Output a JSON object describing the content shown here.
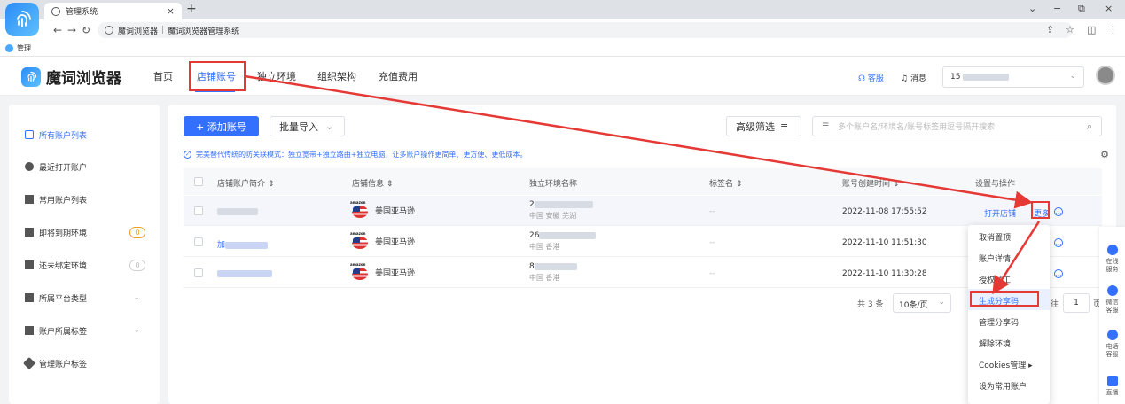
{
  "browser": {
    "tab_title": "管理系统",
    "tab_close": "×",
    "new_tab": "+",
    "url_site": "魔词浏览器",
    "url_sep": "|",
    "url_title": "魔词浏览器管理系统",
    "bookmark": "管理",
    "win_min": "−",
    "win_max": "⧉",
    "win_close": "×",
    "win_dropdown": "⌄"
  },
  "app": {
    "brand": "魔词浏览器",
    "nav": [
      "首页",
      "店铺账号",
      "独立环境",
      "组织架构",
      "充值费用"
    ],
    "active_nav_index": 1,
    "service_link": "客服",
    "message_link": "消息",
    "account_prefix": "15"
  },
  "sidebar": {
    "items": [
      {
        "label": "所有账户列表",
        "icon": "grid-icon",
        "active": true
      },
      {
        "label": "最近打开账户",
        "icon": "clock-icon"
      },
      {
        "label": "常用账户列表",
        "icon": "table-icon"
      },
      {
        "label": "即将到期环境",
        "icon": "calendar-icon",
        "badge": "0",
        "badge_color": "#f0a020"
      },
      {
        "label": "还未绑定环境",
        "icon": "link-icon",
        "badge": "0",
        "badge_color": "#bbbbbb"
      },
      {
        "label": "所属平台类型",
        "icon": "platform-icon",
        "chevron": true
      },
      {
        "label": "账户所属标签",
        "icon": "bookmark-icon",
        "chevron": true
      },
      {
        "label": "管理账户标签",
        "icon": "tag-icon"
      }
    ]
  },
  "toolbar": {
    "add_account": "+ 添加账号",
    "batch_import": "批量导入",
    "advanced_filter": "高级筛选",
    "search_placeholder": "多个账户名/环境名/账号标签用逗号隔开搜索"
  },
  "notice": "完美替代传统的防关联模式：独立宽带+独立路由+独立电脑，让多账户操作更简单、更方便、更低成本。",
  "table": {
    "headers": [
      "店铺账户简介",
      "店铺信息",
      "独立环境名称",
      "标签名",
      "账号创建时间",
      "设置与操作"
    ],
    "rows": [
      {
        "prefix": "",
        "store": "美国亚马逊",
        "env_prefix": "2",
        "env_region": "中国 安徽 芜湖",
        "tag": "--",
        "created": "2022-11-08 17:55:52",
        "action": "打开店铺",
        "more": "更多"
      },
      {
        "prefix": "加",
        "store": "美国亚马逊",
        "env_prefix": "26",
        "env_region": "中国 香港",
        "tag": "--",
        "created": "2022-11-10 11:51:30"
      },
      {
        "prefix": "",
        "store": "美国亚马逊",
        "env_prefix": "8",
        "env_region": "中国 香港",
        "tag": "--",
        "created": "2022-11-10 11:30:28"
      }
    ],
    "flag_label": "amazon"
  },
  "pager": {
    "total": "共 3 条",
    "page_size": "10条/页",
    "goto_prefix": "往",
    "goto_value": "1",
    "goto_suffix": "页"
  },
  "dropdown": {
    "items": [
      "取消置顶",
      "账户详情",
      "授权员工",
      "生成分享码",
      "管理分享码",
      "解除环境",
      "Cookies管理 ▸",
      "设为常用账户"
    ],
    "highlight_index": 3
  },
  "float_bar": {
    "items": [
      "在线\n服务",
      "微信\n客服",
      "电话\n客服",
      "直播"
    ]
  },
  "colors": {
    "accent": "#3470ff",
    "annotation": "#e53935",
    "warning": "#f0a020"
  }
}
